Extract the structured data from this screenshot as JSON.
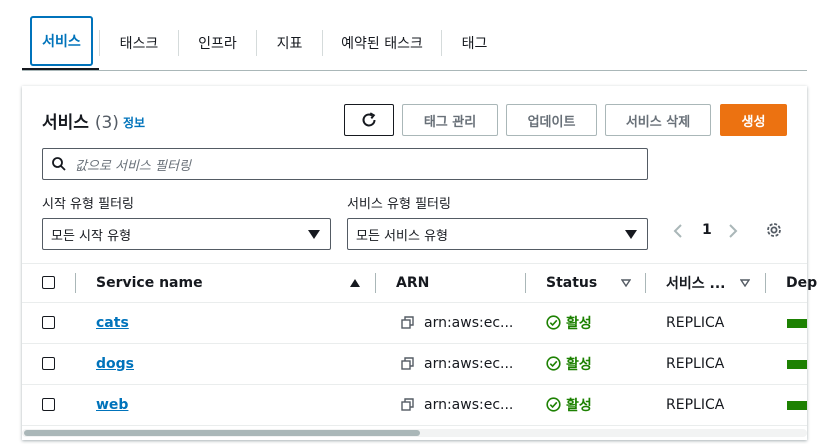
{
  "tabs": [
    {
      "label": "서비스",
      "selected": true
    },
    {
      "label": "태스크",
      "selected": false
    },
    {
      "label": "인프라",
      "selected": false
    },
    {
      "label": "지표",
      "selected": false
    },
    {
      "label": "예약된 태스크",
      "selected": false
    },
    {
      "label": "태그",
      "selected": false
    }
  ],
  "panel": {
    "title": "서비스",
    "count": "(3)",
    "info_link": "정보"
  },
  "toolbar": {
    "refresh_icon": "refresh-icon",
    "manage_tags_label": "태그 관리",
    "update_label": "업데이트",
    "delete_label": "서비스 삭제",
    "create_label": "생성"
  },
  "search": {
    "placeholder": "값으로 서비스 필터링"
  },
  "filters": {
    "launch_type_label": "시작 유형 필터링",
    "launch_type_value": "모든 시작 유형",
    "service_type_label": "서비스 유형 필터링",
    "service_type_value": "모든 서비스 유형"
  },
  "pagination": {
    "current_page": "1"
  },
  "table": {
    "headers": {
      "service_name": "Service name",
      "arn": "ARN",
      "status": "Status",
      "service_type": "서비스 ...",
      "deployments": "Dep"
    },
    "rows": [
      {
        "name": "cats",
        "arn": "arn:aws:ec...",
        "status": "활성",
        "type": "REPLICA"
      },
      {
        "name": "dogs",
        "arn": "arn:aws:ec...",
        "status": "활성",
        "type": "REPLICA"
      },
      {
        "name": "web",
        "arn": "arn:aws:ec...",
        "status": "활성",
        "type": "REPLICA"
      }
    ]
  },
  "colors": {
    "accent": "#0073bb",
    "primary_button": "#ec7211",
    "success": "#1d8102"
  }
}
